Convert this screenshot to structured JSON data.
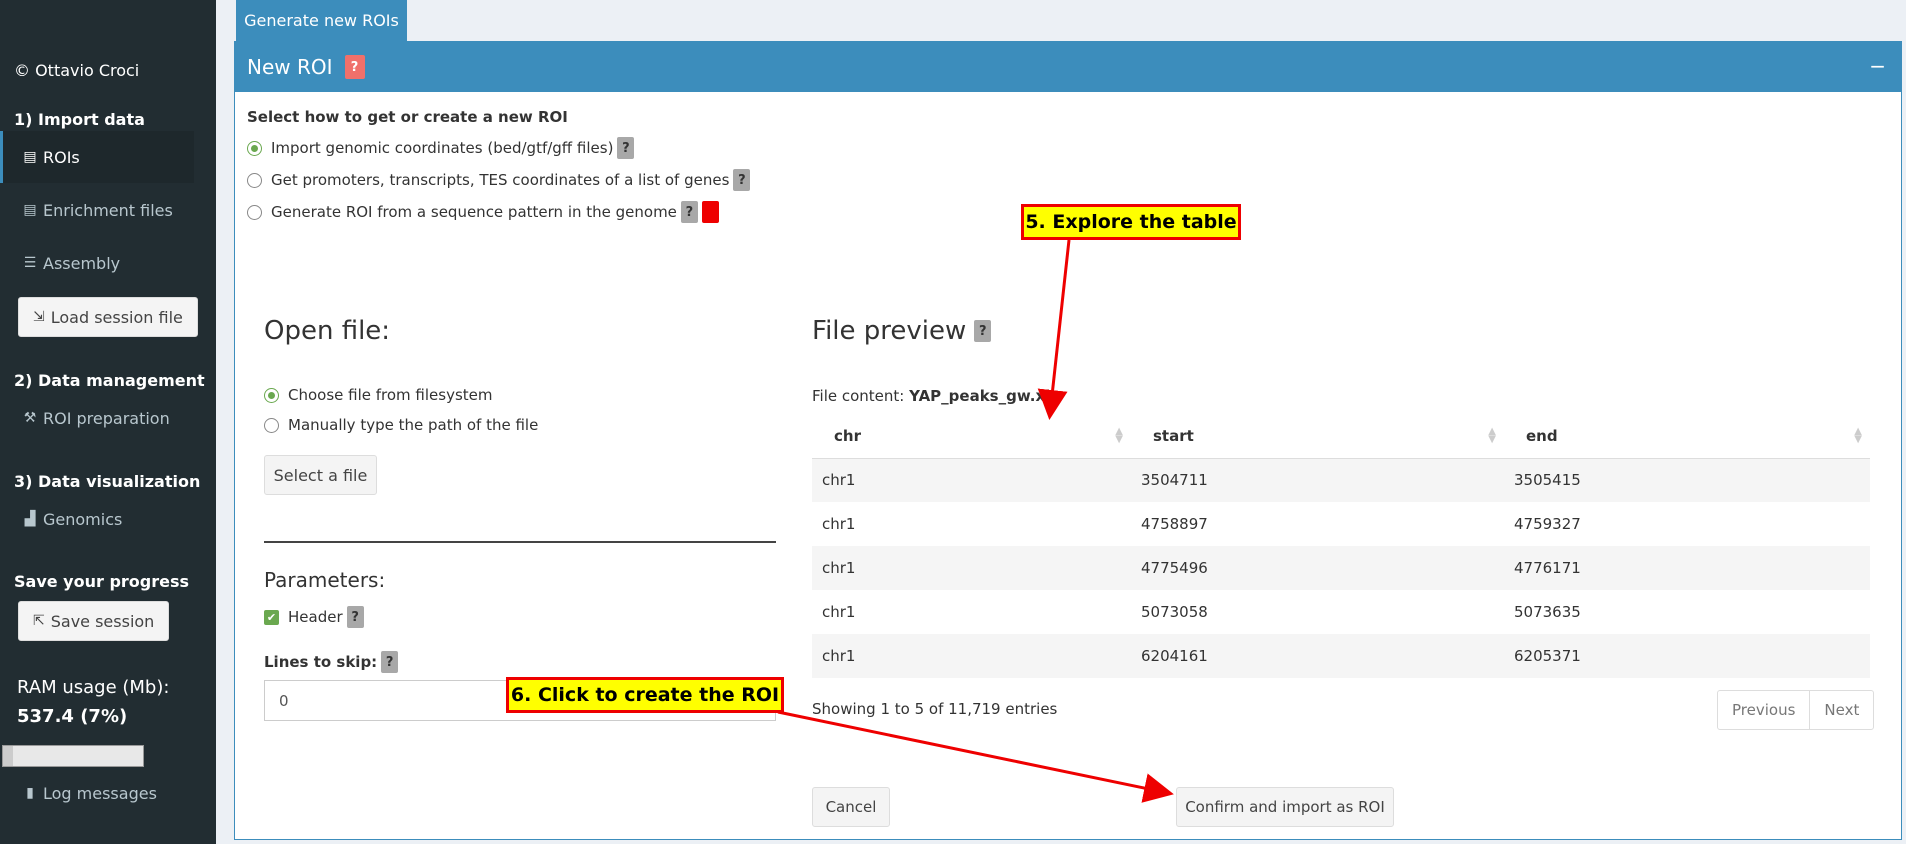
{
  "sidebar": {
    "copyright": "© Ottavio Croci",
    "section_import": "1) Import data",
    "item_rois": "ROIs",
    "item_enrichment": "Enrichment files",
    "item_assembly": "Assembly",
    "load_session": "Load session file",
    "section_management": "2) Data management",
    "item_roi_prep": "ROI preparation",
    "section_visualization": "3) Data visualization",
    "item_genomics": "Genomics",
    "save_progress": "Save your progress",
    "save_session": "Save session",
    "ram_label": "RAM usage (Mb):",
    "ram_value": "537.4 (7%)",
    "ram_percent": 7,
    "log_messages": "Log messages"
  },
  "tab": {
    "label": "Generate new ROIs"
  },
  "box": {
    "title": "New ROI",
    "help": "?",
    "collapse": "−",
    "select_label": "Select how to get or create a new ROI",
    "options": [
      "Import genomic coordinates (bed/gtf/gff files)",
      "Get promoters, transcripts, TES coordinates of a list of genes",
      "Generate ROI from a sequence pattern in the genome"
    ],
    "selected_option": 0
  },
  "open_file": {
    "title": "Open file:",
    "option_fs": "Choose file from filesystem",
    "option_manual": "Manually type the path of the file",
    "select_button": "Select a file",
    "params_title": "Parameters:",
    "header_label": "Header",
    "lines_skip_label": "Lines to skip:",
    "lines_skip_value": "0"
  },
  "preview": {
    "title": "File preview",
    "file_content_label": "File content:",
    "file_name": "YAP_peaks_gw.xls",
    "columns": [
      "chr",
      "start",
      "end"
    ],
    "rows": [
      [
        "chr1",
        "3504711",
        "3505415"
      ],
      [
        "chr1",
        "4758897",
        "4759327"
      ],
      [
        "chr1",
        "4775496",
        "4776171"
      ],
      [
        "chr1",
        "5073058",
        "5073635"
      ],
      [
        "chr1",
        "6204161",
        "6205371"
      ]
    ],
    "info": "Showing 1 to 5 of 11,719 entries",
    "prev": "Previous",
    "next": "Next",
    "cancel": "Cancel",
    "confirm": "Confirm and import as ROI"
  },
  "annotations": {
    "explore": "5. Explore the table",
    "click": "6. Click to create the ROI",
    "color": "#ee0000"
  }
}
